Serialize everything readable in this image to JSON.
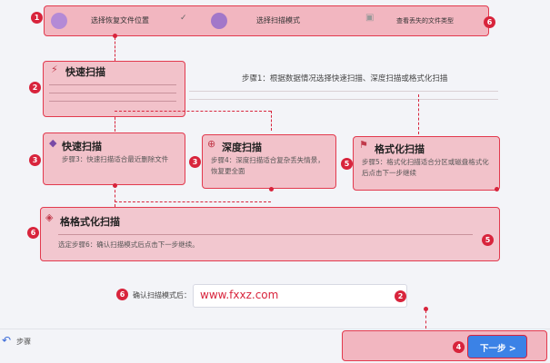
{
  "steps": {
    "step1": "选择恢复文件位置",
    "step2": "选择扫描模式",
    "step3": "查看丢失的文件类型"
  },
  "intro": {
    "line1": "步骤1：根据数据情况选择快速扫描、深度扫描或格式化扫描"
  },
  "cards": {
    "quick_top": {
      "title": "快速扫描"
    },
    "quick": {
      "title": "快速扫描",
      "desc": "步骤3：快速扫描适合最近删除文件"
    },
    "deep": {
      "title": "深度扫描",
      "desc": "步骤4：深度扫描适合复杂丢失情景，恢复更全面"
    },
    "format": {
      "title": "格式化扫描",
      "desc": "步骤5：格式化扫描适合分区或磁盘格式化后点击下一步继续"
    },
    "reformat": {
      "title": "格格式化扫描",
      "desc": "选定步骤6：确认扫描模式后点击下一步继续。"
    }
  },
  "confirm": {
    "label": "确认扫描模式后：",
    "value": "www.fxxz.com"
  },
  "footer": {
    "back_label": "步骤",
    "next_label": "下一步 >"
  },
  "markers": [
    "1",
    "2",
    "3",
    "4",
    "5",
    "6"
  ]
}
